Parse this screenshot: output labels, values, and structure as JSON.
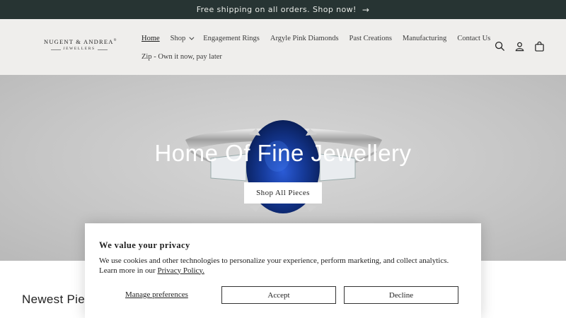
{
  "announcement": {
    "text": "Free shipping on all orders. Shop now!",
    "arrow": "→"
  },
  "logo": {
    "line1": "NUGENT & ANDREA",
    "mark": "®",
    "line2": "JEWELLERS"
  },
  "nav": {
    "items": [
      {
        "label": "Home",
        "active": true
      },
      {
        "label": "Shop",
        "dropdown": true
      },
      {
        "label": "Engagement Rings"
      },
      {
        "label": "Argyle Pink Diamonds"
      },
      {
        "label": "Past Creations"
      },
      {
        "label": "Manufacturing"
      },
      {
        "label": "Contact Us"
      },
      {
        "label": "Zip - Own it now, pay later"
      }
    ]
  },
  "header_icons": [
    "search-icon",
    "account-icon",
    "cart-icon"
  ],
  "hero": {
    "title": "Home Of Fine Jewellery",
    "button": "Shop All Pieces"
  },
  "section": {
    "title": "Newest Pieces"
  },
  "cookie": {
    "title": "We value your privacy",
    "text": "We use cookies and other technologies to personalize your experience, perform marketing, and collect analytics. Learn more in our ",
    "link": "Privacy Policy.",
    "manage": "Manage preferences",
    "accept": "Accept",
    "decline": "Decline"
  },
  "colors": {
    "announcement_bg": "#273433",
    "header_bg": "#efeeec",
    "sapphire": "#0f2a6e"
  }
}
